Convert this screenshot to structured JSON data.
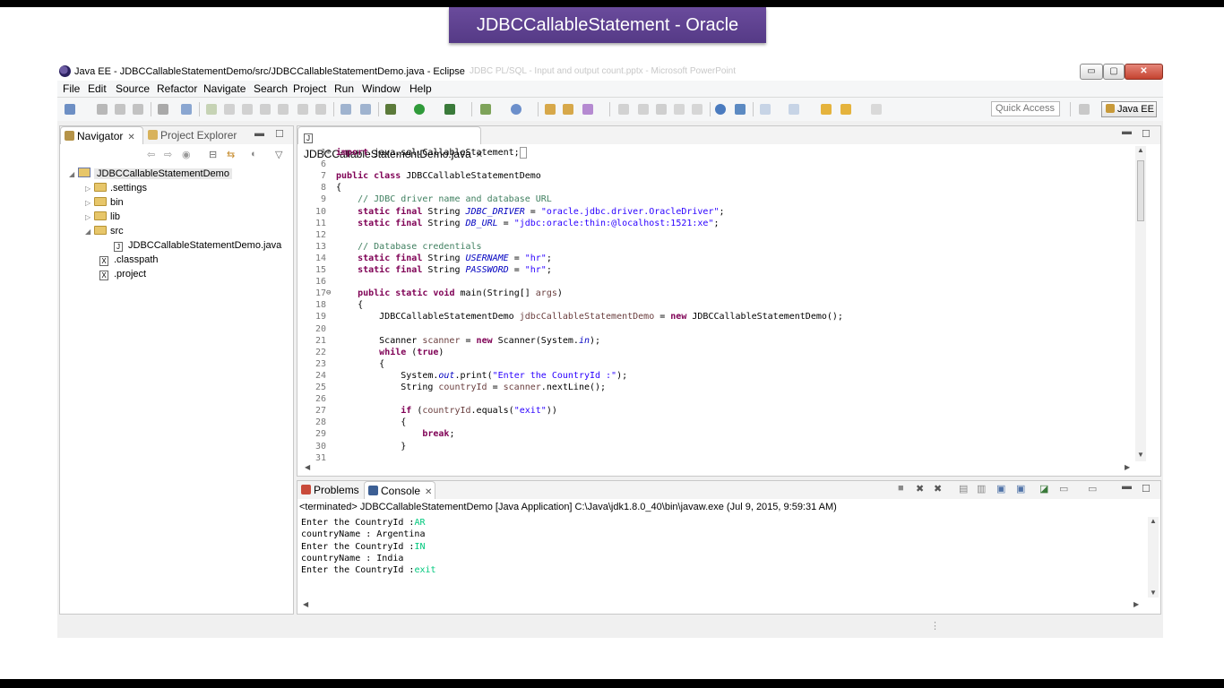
{
  "banner": {
    "title": "JDBCCallableStatement - Oracle"
  },
  "window": {
    "title": "Java EE - JDBCCallableStatementDemo/src/JDBCCallableStatementDemo.java - Eclipse",
    "ghost_title": "JDBC PL/SQL - Input and output count.pptx - Microsoft PowerPoint",
    "controls": {
      "minimize": "▭",
      "maximize": "▢",
      "close": "✕"
    }
  },
  "menu": [
    "File",
    "Edit",
    "Source",
    "Refactor",
    "Navigate",
    "Search",
    "Project",
    "Run",
    "Window",
    "Help"
  ],
  "toolbar": {
    "quick_access": "Quick Access",
    "perspective": "Java EE"
  },
  "navigator": {
    "tabs": {
      "navigator": "Navigator",
      "project_explorer": "Project Explorer"
    },
    "tree": {
      "project": "JDBCCallableStatementDemo",
      "settings": ".settings",
      "bin": "bin",
      "lib": "lib",
      "src": "src",
      "java_file": "JDBCCallableStatementDemo.java",
      "classpath": ".classpath",
      "project_file": ".project"
    }
  },
  "editor": {
    "tab": "JDBCCallableStatementDemo.java",
    "lines": [
      {
        "n": "1",
        "fold": "⊕",
        "html": "<span class=\"kw\">import</span> java.sql.CallableStatement;<span style=\"border:1px solid #999\">&nbsp;</span>"
      },
      {
        "n": "6",
        "html": ""
      },
      {
        "n": "7",
        "html": "<span class=\"kw\">public class</span> JDBCCallableStatementDemo"
      },
      {
        "n": "8",
        "html": "{"
      },
      {
        "n": "9",
        "html": "    <span class=\"cm\">// JDBC driver name and database URL</span>"
      },
      {
        "n": "10",
        "html": "    <span class=\"kw\">static final</span> String <span class=\"fld\">JDBC_DRIVER</span> = <span class=\"str\">\"oracle.jdbc.driver.OracleDriver\"</span>;"
      },
      {
        "n": "11",
        "html": "    <span class=\"kw\">static final</span> String <span class=\"fld\">DB_URL</span> = <span class=\"str\">\"jdbc:oracle:thin:@localhost:1521:xe\"</span>;"
      },
      {
        "n": "12",
        "html": ""
      },
      {
        "n": "13",
        "html": "    <span class=\"cm\">// Database credentials</span>"
      },
      {
        "n": "14",
        "html": "    <span class=\"kw\">static final</span> String <span class=\"fld\">USERNAME</span> = <span class=\"str\">\"hr\"</span>;"
      },
      {
        "n": "15",
        "html": "    <span class=\"kw\">static final</span> String <span class=\"fld\">PASSWORD</span> = <span class=\"str\">\"hr\"</span>;"
      },
      {
        "n": "16",
        "html": ""
      },
      {
        "n": "17",
        "fold": "⊖",
        "html": "    <span class=\"kw\">public static void</span> main(String[] <span class=\"var\">args</span>)"
      },
      {
        "n": "18",
        "html": "    {"
      },
      {
        "n": "19",
        "html": "        JDBCCallableStatementDemo <span class=\"var\">jdbcCallableStatementDemo</span> = <span class=\"kw\">new</span> JDBCCallableStatementDemo();"
      },
      {
        "n": "20",
        "html": ""
      },
      {
        "n": "21",
        "html": "        Scanner <span class=\"var\">scanner</span> = <span class=\"kw\">new</span> Scanner(System.<span class=\"fld\">in</span>);"
      },
      {
        "n": "22",
        "html": "        <span class=\"kw\">while</span> (<span class=\"kw\">true</span>)"
      },
      {
        "n": "23",
        "html": "        {"
      },
      {
        "n": "24",
        "html": "            System.<span class=\"fld\">out</span>.print(<span class=\"str\">\"Enter the CountryId :\"</span>);"
      },
      {
        "n": "25",
        "html": "            String <span class=\"var\">countryId</span> = <span class=\"var\">scanner</span>.nextLine();"
      },
      {
        "n": "26",
        "html": ""
      },
      {
        "n": "27",
        "html": "            <span class=\"kw\">if</span> (<span class=\"var\">countryId</span>.equals(<span class=\"str\">\"exit\"</span>))"
      },
      {
        "n": "28",
        "html": "            {"
      },
      {
        "n": "29",
        "html": "                <span class=\"kw\">break</span>;"
      },
      {
        "n": "30",
        "html": "            }"
      },
      {
        "n": "31",
        "html": ""
      }
    ]
  },
  "bottom": {
    "tabs": {
      "problems": "Problems",
      "console": "Console"
    },
    "terminated": "<terminated> JDBCCallableStatementDemo [Java Application] C:\\Java\\jdk1.8.0_40\\bin\\javaw.exe (Jul 9, 2015, 9:59:31 AM)",
    "console": [
      {
        "text": "Enter the CountryId :",
        "input": "AR"
      },
      {
        "text": "countryName : Argentina",
        "input": ""
      },
      {
        "text": "Enter the CountryId :",
        "input": "IN"
      },
      {
        "text": "countryName : India",
        "input": ""
      },
      {
        "text": "Enter the CountryId :",
        "input": "exit"
      }
    ]
  }
}
